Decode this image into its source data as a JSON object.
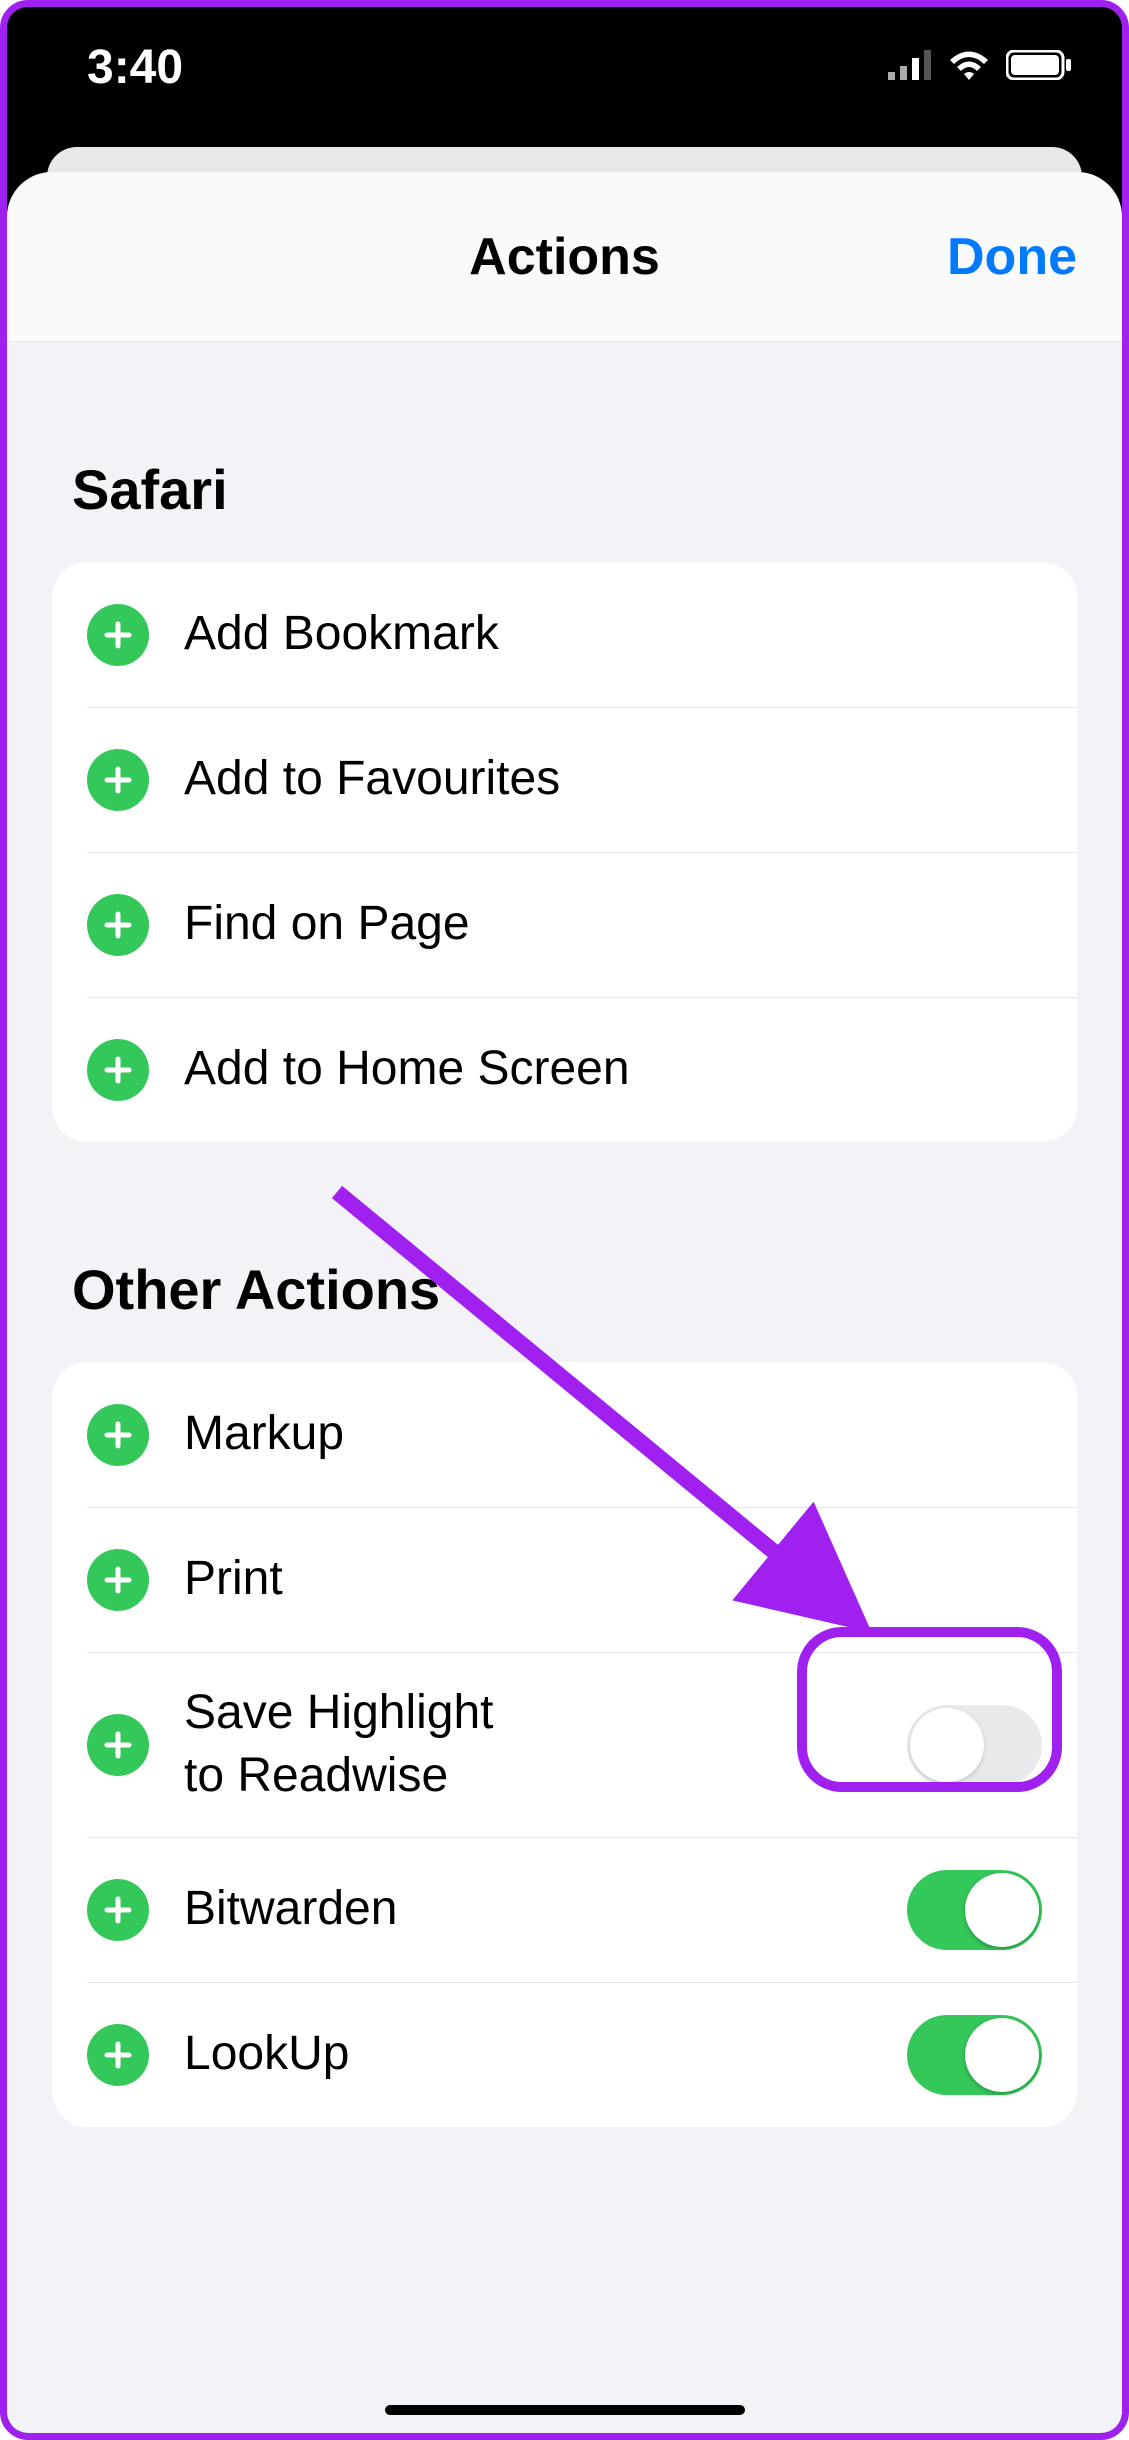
{
  "status": {
    "time": "3:40"
  },
  "header": {
    "title": "Actions",
    "done": "Done"
  },
  "sections": {
    "safari": {
      "title": "Safari",
      "items": [
        {
          "label": "Add Bookmark",
          "name": "add-bookmark"
        },
        {
          "label": "Add to Favourites",
          "name": "add-to-favourites"
        },
        {
          "label": "Find on Page",
          "name": "find-on-page"
        },
        {
          "label": "Add to Home Screen",
          "name": "add-to-home-screen"
        }
      ]
    },
    "other": {
      "title": "Other Actions",
      "items": [
        {
          "label": "Markup",
          "name": "markup",
          "toggle": null
        },
        {
          "label": "Print",
          "name": "print",
          "toggle": null
        },
        {
          "label": "Save Highlight",
          "label2": "to Readwise",
          "name": "save-highlight-to-readwise",
          "toggle": "off",
          "highlighted": true
        },
        {
          "label": "Bitwarden",
          "name": "bitwarden",
          "toggle": "on"
        },
        {
          "label": "LookUp",
          "name": "lookup",
          "toggle": "on"
        }
      ]
    }
  },
  "annotation": {
    "arrow_color": "#A020F0"
  }
}
